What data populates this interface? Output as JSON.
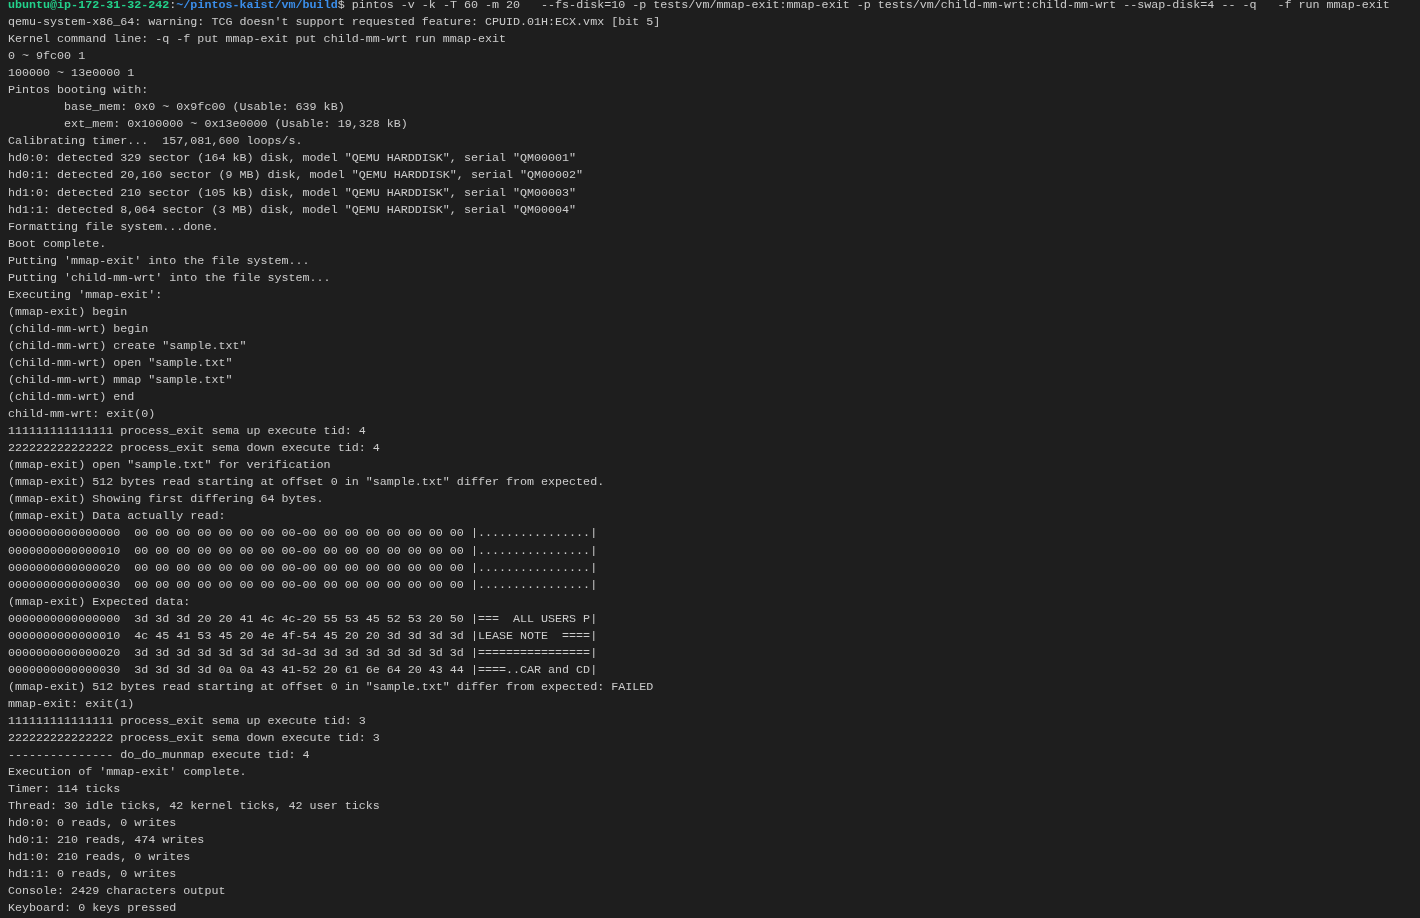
{
  "terminal": {
    "prompt": {
      "user_host": "ubuntu@ip-172-31-32-242",
      "separator": ":",
      "path": "~/pintos-kaist/vm/build",
      "symbol": "$",
      "command": " pintos -v -k -T 60 -m 20   --fs-disk=10 -p tests/vm/mmap-exit:mmap-exit -p tests/vm/child-mm-wrt:child-mm-wrt --swap-disk=4 -- -q   -f run mmap-exit"
    },
    "lines": [
      "qemu-system-x86_64: warning: TCG doesn't support requested feature: CPUID.01H:ECX.vmx [bit 5]",
      "Kernel command line: -q -f put mmap-exit put child-mm-wrt run mmap-exit",
      "0 ~ 9fc00 1",
      "100000 ~ 13e0000 1",
      "Pintos booting with:",
      "        base_mem: 0x0 ~ 0x9fc00 (Usable: 639 kB)",
      "        ext_mem: 0x100000 ~ 0x13e0000 (Usable: 19,328 kB)",
      "Calibrating timer...  157,081,600 loops/s.",
      "hd0:0: detected 329 sector (164 kB) disk, model \"QEMU HARDDISK\", serial \"QM00001\"",
      "hd0:1: detected 20,160 sector (9 MB) disk, model \"QEMU HARDDISK\", serial \"QM00002\"",
      "hd1:0: detected 210 sector (105 kB) disk, model \"QEMU HARDDISK\", serial \"QM00003\"",
      "hd1:1: detected 8,064 sector (3 MB) disk, model \"QEMU HARDDISK\", serial \"QM00004\"",
      "Formatting file system...done.",
      "Boot complete.",
      "Putting 'mmap-exit' into the file system...",
      "Putting 'child-mm-wrt' into the file system...",
      "Executing 'mmap-exit':",
      "(mmap-exit) begin",
      "(child-mm-wrt) begin",
      "(child-mm-wrt) create \"sample.txt\"",
      "(child-mm-wrt) open \"sample.txt\"",
      "(child-mm-wrt) mmap \"sample.txt\"",
      "(child-mm-wrt) end",
      "child-mm-wrt: exit(0)",
      "111111111111111 process_exit sema up execute tid: 4",
      "222222222222222 process_exit sema down execute tid: 4",
      "(mmap-exit) open \"sample.txt\" for verification",
      "(mmap-exit) 512 bytes read starting at offset 0 in \"sample.txt\" differ from expected.",
      "(mmap-exit) Showing first differing 64 bytes.",
      "(mmap-exit) Data actually read:",
      "0000000000000000  00 00 00 00 00 00 00 00-00 00 00 00 00 00 00 00 |................|",
      "0000000000000010  00 00 00 00 00 00 00 00-00 00 00 00 00 00 00 00 |................|",
      "0000000000000020  00 00 00 00 00 00 00 00-00 00 00 00 00 00 00 00 |................|",
      "0000000000000030  00 00 00 00 00 00 00 00-00 00 00 00 00 00 00 00 |................|",
      "(mmap-exit) Expected data:",
      "0000000000000000  3d 3d 3d 20 20 41 4c 4c-20 55 53 45 52 53 20 50 |===  ALL USERS P|",
      "0000000000000010  4c 45 41 53 45 20 4e 4f-54 45 20 20 3d 3d 3d 3d |LEASE NOTE  ====|",
      "0000000000000020  3d 3d 3d 3d 3d 3d 3d 3d-3d 3d 3d 3d 3d 3d 3d 3d |================|",
      "0000000000000030  3d 3d 3d 3d 0a 0a 43 41-52 20 61 6e 64 20 43 44 |====..CAR and CD|",
      "(mmap-exit) 512 bytes read starting at offset 0 in \"sample.txt\" differ from expected: FAILED",
      "mmap-exit: exit(1)",
      "111111111111111 process_exit sema up execute tid: 3",
      "222222222222222 process_exit sema down execute tid: 3",
      "--------------- do_do_munmap execute tid: 4",
      "Execution of 'mmap-exit' complete.",
      "Timer: 114 ticks",
      "Thread: 30 idle ticks, 42 kernel ticks, 42 user ticks",
      "hd0:0: 0 reads, 0 writes",
      "hd0:1: 210 reads, 474 writes",
      "hd1:0: 210 reads, 0 writes",
      "hd1:1: 0 reads, 0 writes",
      "Console: 2429 characters output",
      "Keyboard: 0 keys pressed"
    ]
  }
}
